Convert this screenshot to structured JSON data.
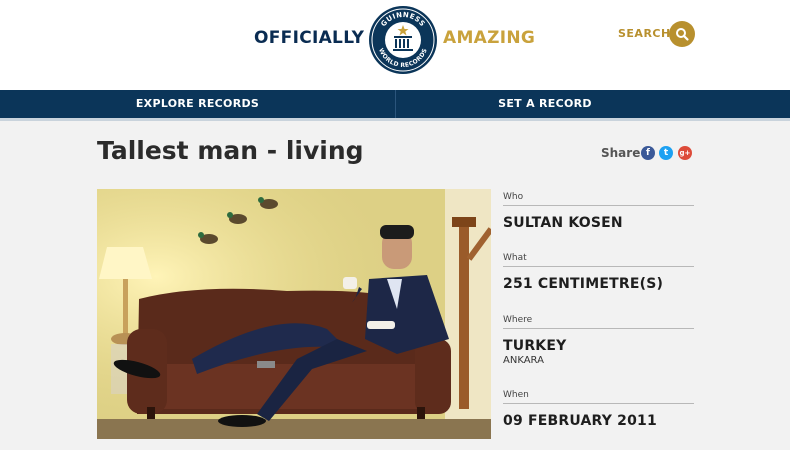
{
  "header": {
    "brand_left": "OFFICIALLY",
    "brand_right": "AMAZING",
    "logo_text_top": "GUINNESS",
    "logo_text_bottom": "WORLD RECORDS",
    "search_label": "SEARCH"
  },
  "nav": {
    "items": [
      "EXPLORE RECORDS",
      "SET A RECORD"
    ]
  },
  "record": {
    "title": "Tallest man - living",
    "share_label": "Share",
    "share_icons": [
      "f",
      "t",
      "g+"
    ],
    "who_label": "Who",
    "who_value": "SULTAN KOSEN",
    "what_label": "What",
    "what_value": "251 CENTIMETRE(S)",
    "where_label": "Where",
    "where_value": "TURKEY",
    "where_sub": "ANKARA",
    "when_label": "When",
    "when_value": "09 FEBRUARY 2011"
  },
  "colors": {
    "navy": "#0b3559",
    "gold": "#c9a23c",
    "facebook": "#3b5998",
    "twitter": "#1da1f2",
    "google": "#dd4b39"
  }
}
